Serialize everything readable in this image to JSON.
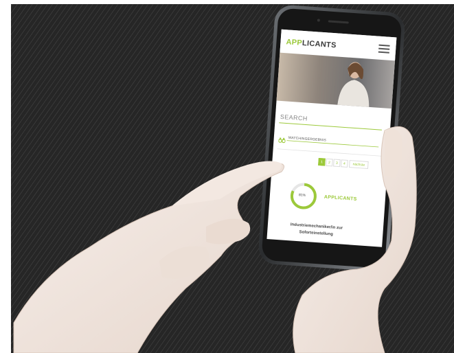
{
  "app": {
    "logo_highlight": "APP",
    "logo_rest": "LICANTS",
    "menu_icon": "hamburger-menu-icon"
  },
  "search": {
    "title": "SEARCH",
    "result_label": "MATCHINGERGEBNIS",
    "result_icon": "binoculars-icon"
  },
  "pagination": {
    "pages": [
      "1",
      "2",
      "3",
      "4"
    ],
    "active_page": "1",
    "next_label": "nächste"
  },
  "match_card": {
    "percent_text": "81%",
    "percent_value": 0.81,
    "company_logo_highlight": "APP",
    "company_logo_rest": "LICANTS",
    "job_title_line1": "Industriemechaniker/in zur",
    "job_title_line2": "Soforteinstellung"
  },
  "colors": {
    "accent_green": "#9cc93a",
    "background_dark": "#262626",
    "phone_frame": "#1a1a1a"
  }
}
